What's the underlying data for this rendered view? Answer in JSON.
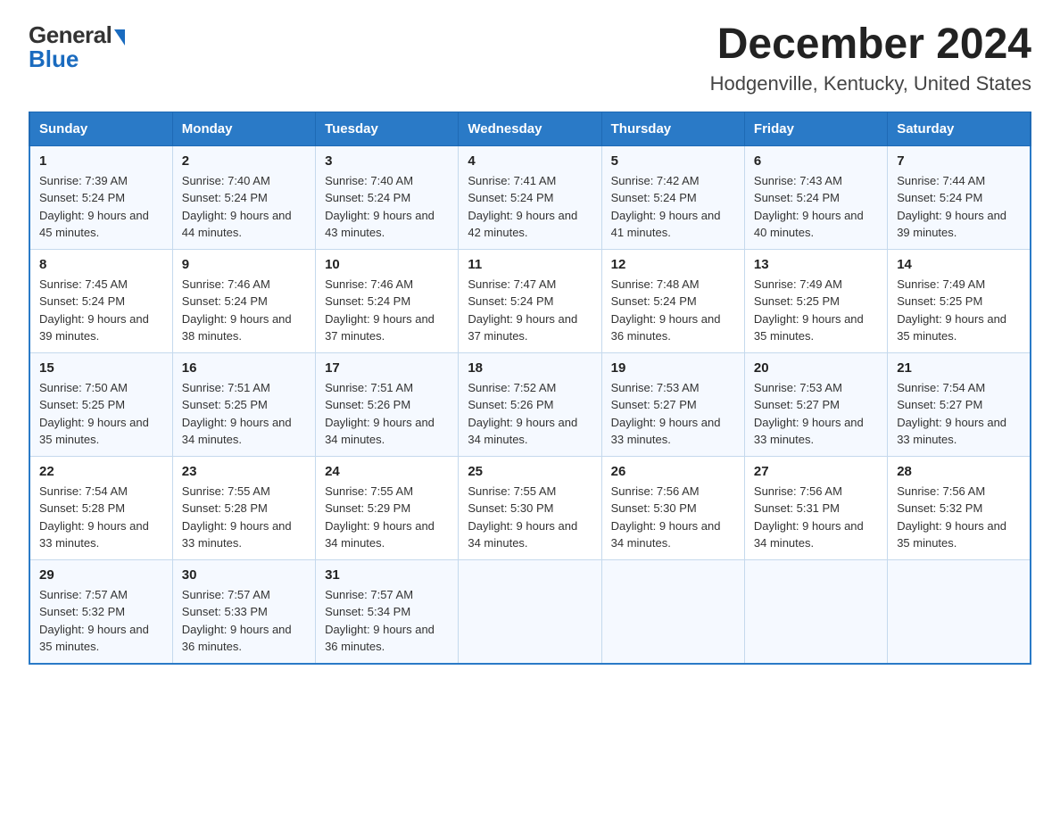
{
  "header": {
    "logo": {
      "general": "General",
      "blue": "Blue"
    },
    "title": "December 2024",
    "subtitle": "Hodgenville, Kentucky, United States"
  },
  "weekdays": [
    "Sunday",
    "Monday",
    "Tuesday",
    "Wednesday",
    "Thursday",
    "Friday",
    "Saturday"
  ],
  "weeks": [
    [
      {
        "day": "1",
        "sunrise": "7:39 AM",
        "sunset": "5:24 PM",
        "daylight": "9 hours and 45 minutes."
      },
      {
        "day": "2",
        "sunrise": "7:40 AM",
        "sunset": "5:24 PM",
        "daylight": "9 hours and 44 minutes."
      },
      {
        "day": "3",
        "sunrise": "7:40 AM",
        "sunset": "5:24 PM",
        "daylight": "9 hours and 43 minutes."
      },
      {
        "day": "4",
        "sunrise": "7:41 AM",
        "sunset": "5:24 PM",
        "daylight": "9 hours and 42 minutes."
      },
      {
        "day": "5",
        "sunrise": "7:42 AM",
        "sunset": "5:24 PM",
        "daylight": "9 hours and 41 minutes."
      },
      {
        "day": "6",
        "sunrise": "7:43 AM",
        "sunset": "5:24 PM",
        "daylight": "9 hours and 40 minutes."
      },
      {
        "day": "7",
        "sunrise": "7:44 AM",
        "sunset": "5:24 PM",
        "daylight": "9 hours and 39 minutes."
      }
    ],
    [
      {
        "day": "8",
        "sunrise": "7:45 AM",
        "sunset": "5:24 PM",
        "daylight": "9 hours and 39 minutes."
      },
      {
        "day": "9",
        "sunrise": "7:46 AM",
        "sunset": "5:24 PM",
        "daylight": "9 hours and 38 minutes."
      },
      {
        "day": "10",
        "sunrise": "7:46 AM",
        "sunset": "5:24 PM",
        "daylight": "9 hours and 37 minutes."
      },
      {
        "day": "11",
        "sunrise": "7:47 AM",
        "sunset": "5:24 PM",
        "daylight": "9 hours and 37 minutes."
      },
      {
        "day": "12",
        "sunrise": "7:48 AM",
        "sunset": "5:24 PM",
        "daylight": "9 hours and 36 minutes."
      },
      {
        "day": "13",
        "sunrise": "7:49 AM",
        "sunset": "5:25 PM",
        "daylight": "9 hours and 35 minutes."
      },
      {
        "day": "14",
        "sunrise": "7:49 AM",
        "sunset": "5:25 PM",
        "daylight": "9 hours and 35 minutes."
      }
    ],
    [
      {
        "day": "15",
        "sunrise": "7:50 AM",
        "sunset": "5:25 PM",
        "daylight": "9 hours and 35 minutes."
      },
      {
        "day": "16",
        "sunrise": "7:51 AM",
        "sunset": "5:25 PM",
        "daylight": "9 hours and 34 minutes."
      },
      {
        "day": "17",
        "sunrise": "7:51 AM",
        "sunset": "5:26 PM",
        "daylight": "9 hours and 34 minutes."
      },
      {
        "day": "18",
        "sunrise": "7:52 AM",
        "sunset": "5:26 PM",
        "daylight": "9 hours and 34 minutes."
      },
      {
        "day": "19",
        "sunrise": "7:53 AM",
        "sunset": "5:27 PM",
        "daylight": "9 hours and 33 minutes."
      },
      {
        "day": "20",
        "sunrise": "7:53 AM",
        "sunset": "5:27 PM",
        "daylight": "9 hours and 33 minutes."
      },
      {
        "day": "21",
        "sunrise": "7:54 AM",
        "sunset": "5:27 PM",
        "daylight": "9 hours and 33 minutes."
      }
    ],
    [
      {
        "day": "22",
        "sunrise": "7:54 AM",
        "sunset": "5:28 PM",
        "daylight": "9 hours and 33 minutes."
      },
      {
        "day": "23",
        "sunrise": "7:55 AM",
        "sunset": "5:28 PM",
        "daylight": "9 hours and 33 minutes."
      },
      {
        "day": "24",
        "sunrise": "7:55 AM",
        "sunset": "5:29 PM",
        "daylight": "9 hours and 34 minutes."
      },
      {
        "day": "25",
        "sunrise": "7:55 AM",
        "sunset": "5:30 PM",
        "daylight": "9 hours and 34 minutes."
      },
      {
        "day": "26",
        "sunrise": "7:56 AM",
        "sunset": "5:30 PM",
        "daylight": "9 hours and 34 minutes."
      },
      {
        "day": "27",
        "sunrise": "7:56 AM",
        "sunset": "5:31 PM",
        "daylight": "9 hours and 34 minutes."
      },
      {
        "day": "28",
        "sunrise": "7:56 AM",
        "sunset": "5:32 PM",
        "daylight": "9 hours and 35 minutes."
      }
    ],
    [
      {
        "day": "29",
        "sunrise": "7:57 AM",
        "sunset": "5:32 PM",
        "daylight": "9 hours and 35 minutes."
      },
      {
        "day": "30",
        "sunrise": "7:57 AM",
        "sunset": "5:33 PM",
        "daylight": "9 hours and 36 minutes."
      },
      {
        "day": "31",
        "sunrise": "7:57 AM",
        "sunset": "5:34 PM",
        "daylight": "9 hours and 36 minutes."
      },
      null,
      null,
      null,
      null
    ]
  ]
}
